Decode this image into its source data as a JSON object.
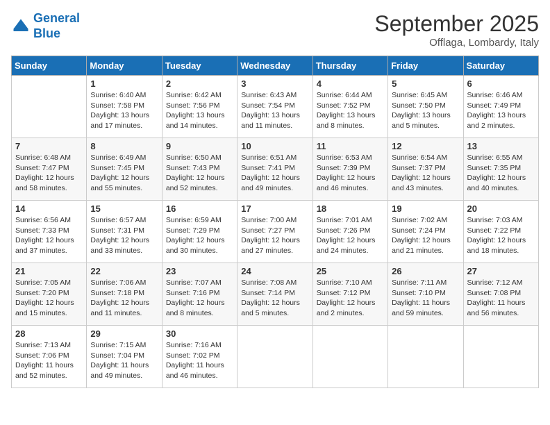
{
  "logo": {
    "text_general": "General",
    "text_blue": "Blue"
  },
  "header": {
    "month": "September 2025",
    "location": "Offlaga, Lombardy, Italy"
  },
  "weekdays": [
    "Sunday",
    "Monday",
    "Tuesday",
    "Wednesday",
    "Thursday",
    "Friday",
    "Saturday"
  ],
  "weeks": [
    [
      {
        "day": "",
        "sunrise": "",
        "sunset": "",
        "daylight": ""
      },
      {
        "day": "1",
        "sunrise": "Sunrise: 6:40 AM",
        "sunset": "Sunset: 7:58 PM",
        "daylight": "Daylight: 13 hours and 17 minutes."
      },
      {
        "day": "2",
        "sunrise": "Sunrise: 6:42 AM",
        "sunset": "Sunset: 7:56 PM",
        "daylight": "Daylight: 13 hours and 14 minutes."
      },
      {
        "day": "3",
        "sunrise": "Sunrise: 6:43 AM",
        "sunset": "Sunset: 7:54 PM",
        "daylight": "Daylight: 13 hours and 11 minutes."
      },
      {
        "day": "4",
        "sunrise": "Sunrise: 6:44 AM",
        "sunset": "Sunset: 7:52 PM",
        "daylight": "Daylight: 13 hours and 8 minutes."
      },
      {
        "day": "5",
        "sunrise": "Sunrise: 6:45 AM",
        "sunset": "Sunset: 7:50 PM",
        "daylight": "Daylight: 13 hours and 5 minutes."
      },
      {
        "day": "6",
        "sunrise": "Sunrise: 6:46 AM",
        "sunset": "Sunset: 7:49 PM",
        "daylight": "Daylight: 13 hours and 2 minutes."
      }
    ],
    [
      {
        "day": "7",
        "sunrise": "Sunrise: 6:48 AM",
        "sunset": "Sunset: 7:47 PM",
        "daylight": "Daylight: 12 hours and 58 minutes."
      },
      {
        "day": "8",
        "sunrise": "Sunrise: 6:49 AM",
        "sunset": "Sunset: 7:45 PM",
        "daylight": "Daylight: 12 hours and 55 minutes."
      },
      {
        "day": "9",
        "sunrise": "Sunrise: 6:50 AM",
        "sunset": "Sunset: 7:43 PM",
        "daylight": "Daylight: 12 hours and 52 minutes."
      },
      {
        "day": "10",
        "sunrise": "Sunrise: 6:51 AM",
        "sunset": "Sunset: 7:41 PM",
        "daylight": "Daylight: 12 hours and 49 minutes."
      },
      {
        "day": "11",
        "sunrise": "Sunrise: 6:53 AM",
        "sunset": "Sunset: 7:39 PM",
        "daylight": "Daylight: 12 hours and 46 minutes."
      },
      {
        "day": "12",
        "sunrise": "Sunrise: 6:54 AM",
        "sunset": "Sunset: 7:37 PM",
        "daylight": "Daylight: 12 hours and 43 minutes."
      },
      {
        "day": "13",
        "sunrise": "Sunrise: 6:55 AM",
        "sunset": "Sunset: 7:35 PM",
        "daylight": "Daylight: 12 hours and 40 minutes."
      }
    ],
    [
      {
        "day": "14",
        "sunrise": "Sunrise: 6:56 AM",
        "sunset": "Sunset: 7:33 PM",
        "daylight": "Daylight: 12 hours and 37 minutes."
      },
      {
        "day": "15",
        "sunrise": "Sunrise: 6:57 AM",
        "sunset": "Sunset: 7:31 PM",
        "daylight": "Daylight: 12 hours and 33 minutes."
      },
      {
        "day": "16",
        "sunrise": "Sunrise: 6:59 AM",
        "sunset": "Sunset: 7:29 PM",
        "daylight": "Daylight: 12 hours and 30 minutes."
      },
      {
        "day": "17",
        "sunrise": "Sunrise: 7:00 AM",
        "sunset": "Sunset: 7:27 PM",
        "daylight": "Daylight: 12 hours and 27 minutes."
      },
      {
        "day": "18",
        "sunrise": "Sunrise: 7:01 AM",
        "sunset": "Sunset: 7:26 PM",
        "daylight": "Daylight: 12 hours and 24 minutes."
      },
      {
        "day": "19",
        "sunrise": "Sunrise: 7:02 AM",
        "sunset": "Sunset: 7:24 PM",
        "daylight": "Daylight: 12 hours and 21 minutes."
      },
      {
        "day": "20",
        "sunrise": "Sunrise: 7:03 AM",
        "sunset": "Sunset: 7:22 PM",
        "daylight": "Daylight: 12 hours and 18 minutes."
      }
    ],
    [
      {
        "day": "21",
        "sunrise": "Sunrise: 7:05 AM",
        "sunset": "Sunset: 7:20 PM",
        "daylight": "Daylight: 12 hours and 15 minutes."
      },
      {
        "day": "22",
        "sunrise": "Sunrise: 7:06 AM",
        "sunset": "Sunset: 7:18 PM",
        "daylight": "Daylight: 12 hours and 11 minutes."
      },
      {
        "day": "23",
        "sunrise": "Sunrise: 7:07 AM",
        "sunset": "Sunset: 7:16 PM",
        "daylight": "Daylight: 12 hours and 8 minutes."
      },
      {
        "day": "24",
        "sunrise": "Sunrise: 7:08 AM",
        "sunset": "Sunset: 7:14 PM",
        "daylight": "Daylight: 12 hours and 5 minutes."
      },
      {
        "day": "25",
        "sunrise": "Sunrise: 7:10 AM",
        "sunset": "Sunset: 7:12 PM",
        "daylight": "Daylight: 12 hours and 2 minutes."
      },
      {
        "day": "26",
        "sunrise": "Sunrise: 7:11 AM",
        "sunset": "Sunset: 7:10 PM",
        "daylight": "Daylight: 11 hours and 59 minutes."
      },
      {
        "day": "27",
        "sunrise": "Sunrise: 7:12 AM",
        "sunset": "Sunset: 7:08 PM",
        "daylight": "Daylight: 11 hours and 56 minutes."
      }
    ],
    [
      {
        "day": "28",
        "sunrise": "Sunrise: 7:13 AM",
        "sunset": "Sunset: 7:06 PM",
        "daylight": "Daylight: 11 hours and 52 minutes."
      },
      {
        "day": "29",
        "sunrise": "Sunrise: 7:15 AM",
        "sunset": "Sunset: 7:04 PM",
        "daylight": "Daylight: 11 hours and 49 minutes."
      },
      {
        "day": "30",
        "sunrise": "Sunrise: 7:16 AM",
        "sunset": "Sunset: 7:02 PM",
        "daylight": "Daylight: 11 hours and 46 minutes."
      },
      {
        "day": "",
        "sunrise": "",
        "sunset": "",
        "daylight": ""
      },
      {
        "day": "",
        "sunrise": "",
        "sunset": "",
        "daylight": ""
      },
      {
        "day": "",
        "sunrise": "",
        "sunset": "",
        "daylight": ""
      },
      {
        "day": "",
        "sunrise": "",
        "sunset": "",
        "daylight": ""
      }
    ]
  ]
}
